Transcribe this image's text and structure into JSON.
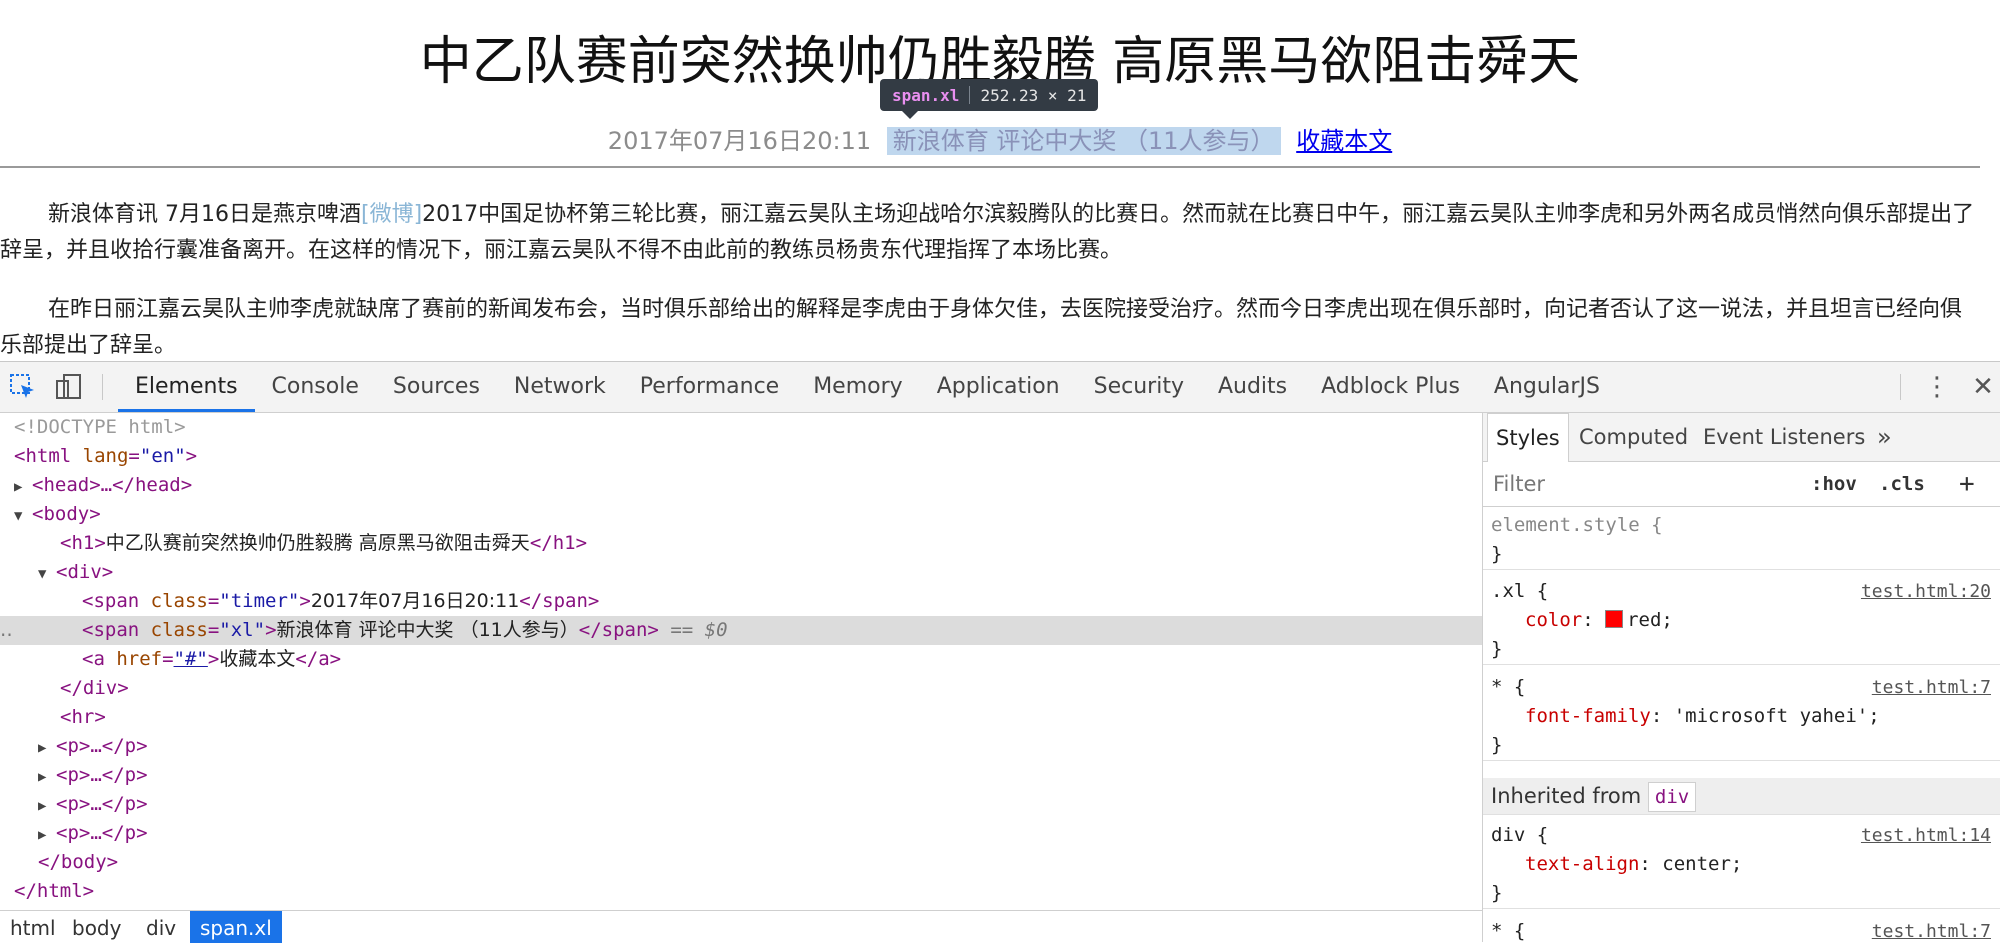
{
  "page": {
    "title": "中乙队赛前突然换帅仍胜毅腾 高原黑马欲阻击舜天",
    "timer": "2017年07月16日20:11",
    "xl_text": "新浪体育 评论中大奖 （11人参与）",
    "collect_link": "收藏本文",
    "p1_before": "新浪体育讯 7月16日是燕京啤酒",
    "p1_weibo": "[微博]",
    "p1_after": "2017中国足协杯第三轮比赛，丽江嘉云昊队主场迎战哈尔滨毅腾队的比赛日。然而就在比赛日中午，丽江嘉云昊队主帅李虎和另外两名成员悄然向俱乐部提出了辞呈，并且收拾行囊准备离开。在这样的情况下，丽江嘉云昊队不得不由此前的教练员杨贵东代理指挥了本场比赛。",
    "p2": "在昨日丽江嘉云昊队主帅李虎就缺席了赛前的新闻发布会，当时俱乐部给出的解释是李虎由于身体欠佳，去医院接受治疗。然而今日李虎出现在俱乐部时，向记者否认了这一说法，并且坦言已经向俱乐部提出了辞呈。"
  },
  "inspect_tooltip": {
    "tag": "span.xl",
    "dims": "252.23 × 21"
  },
  "devtools": {
    "tabs": [
      "Elements",
      "Console",
      "Sources",
      "Network",
      "Performance",
      "Memory",
      "Application",
      "Security",
      "Audits",
      "Adblock Plus",
      "AngularJS"
    ],
    "active_tab": "Elements",
    "dom": {
      "doctype": "<!DOCTYPE html>",
      "html_open": "<html",
      "html_lang_attr": "lang",
      "html_lang_val": "\"en\"",
      "head": "<head>…</head>",
      "body_open": "<body>",
      "h1_text": "中乙队赛前突然换帅仍胜毅腾 高原黑马欲阻击舜天",
      "div_open": "<div>",
      "timer_class": "\"timer\"",
      "timer_text": "2017年07月16日20:11",
      "xl_class": "\"xl\"",
      "xl_text": "新浪体育 评论中大奖 （11人参与）",
      "dollar": "== $0",
      "a_href": "\"#\"",
      "a_text": "收藏本文",
      "div_close": "</div>",
      "hr": "<hr>",
      "p_collapsed": "<p>…</p>",
      "body_close": "</body>",
      "html_close": "</html>"
    },
    "breadcrumbs": [
      "html",
      "body",
      "div",
      "span.xl"
    ],
    "styles": {
      "tabs": [
        "Styles",
        "Computed",
        "Event Listeners"
      ],
      "more": "»",
      "filter_placeholder": "Filter",
      "hov": ":hov",
      "cls": ".cls",
      "add": "+",
      "rules": {
        "element_style": "element.style {",
        "close": "}",
        "xl_sel": ".xl {",
        "xl_prop": "color",
        "xl_val": "red;",
        "src_20": "test.html:20",
        "star_sel": "* {",
        "star_prop": "font-family",
        "star_val": "'microsoft yahei';",
        "src_7": "test.html:7",
        "inherited_label": "Inherited from",
        "inherited_tag": "div",
        "div_sel": "div {",
        "div_prop": "text-align",
        "div_val": "center;",
        "src_14": "test.html:14"
      }
    }
  },
  "colors": {
    "accent": "#1a73e8",
    "swatch": "#ff0000",
    "highlight": "#bfd7ee"
  }
}
